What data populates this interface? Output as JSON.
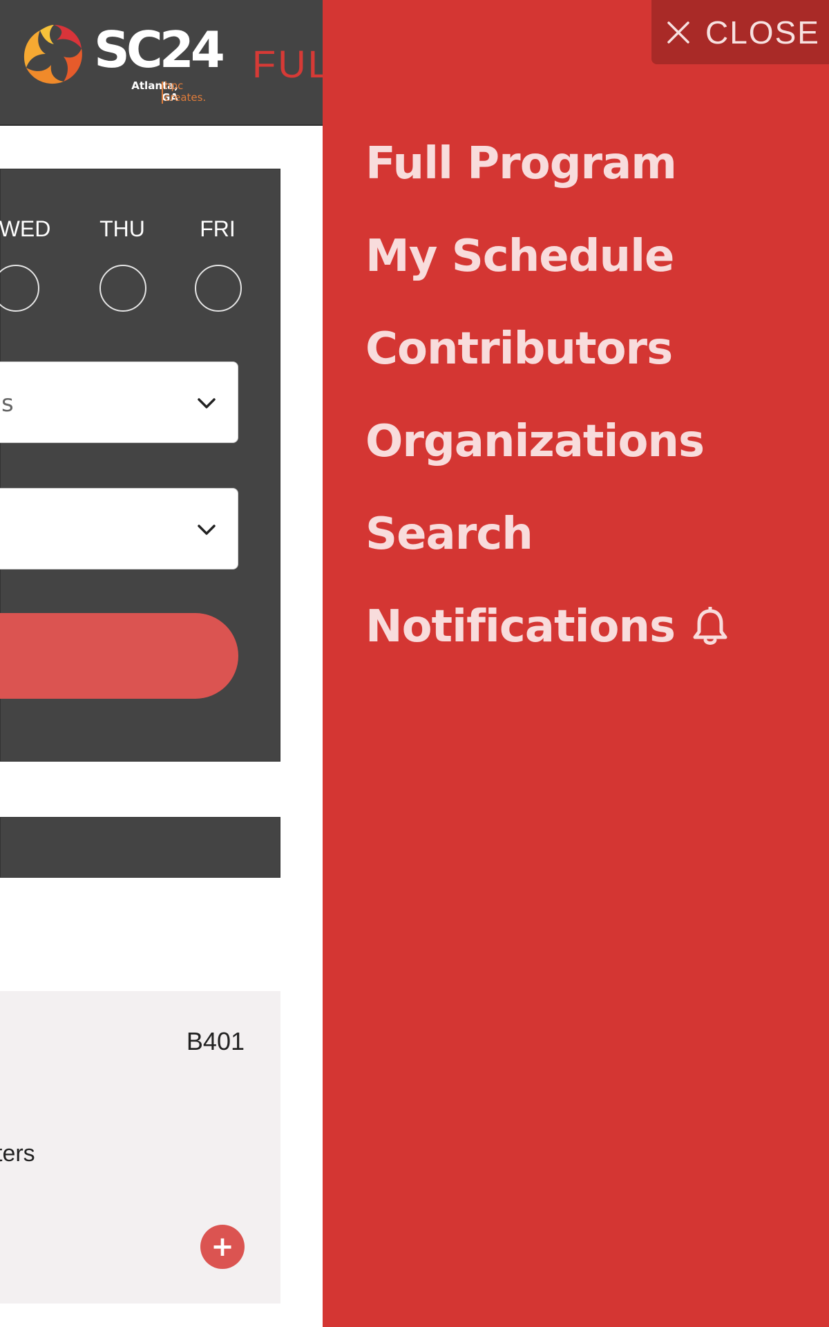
{
  "header": {
    "logo_text": "SC24",
    "logo_sub_left": [
      "Atlanta,",
      "GA"
    ],
    "logo_sub_right": [
      "hpc",
      "creates."
    ],
    "title_partial": "FUL"
  },
  "filters": {
    "days": [
      "WED",
      "THU",
      "FRI"
    ],
    "select_1_stub": "s",
    "select_2_stub": ""
  },
  "card": {
    "room": "B401",
    "text_partial": "ters",
    "add_label": "+"
  },
  "drawer": {
    "close_label": "CLOSE",
    "nav": [
      {
        "label": "Full Program"
      },
      {
        "label": "My Schedule"
      },
      {
        "label": "Contributors"
      },
      {
        "label": "Organizations"
      },
      {
        "label": "Search"
      },
      {
        "label": "Notifications",
        "icon": "bell-icon"
      }
    ]
  },
  "colors": {
    "drawer_bg": "#d43633",
    "close_bg": "#a92a27",
    "nav_text": "#f8dcdc",
    "header_bg": "#444444",
    "accent": "#db5451"
  }
}
